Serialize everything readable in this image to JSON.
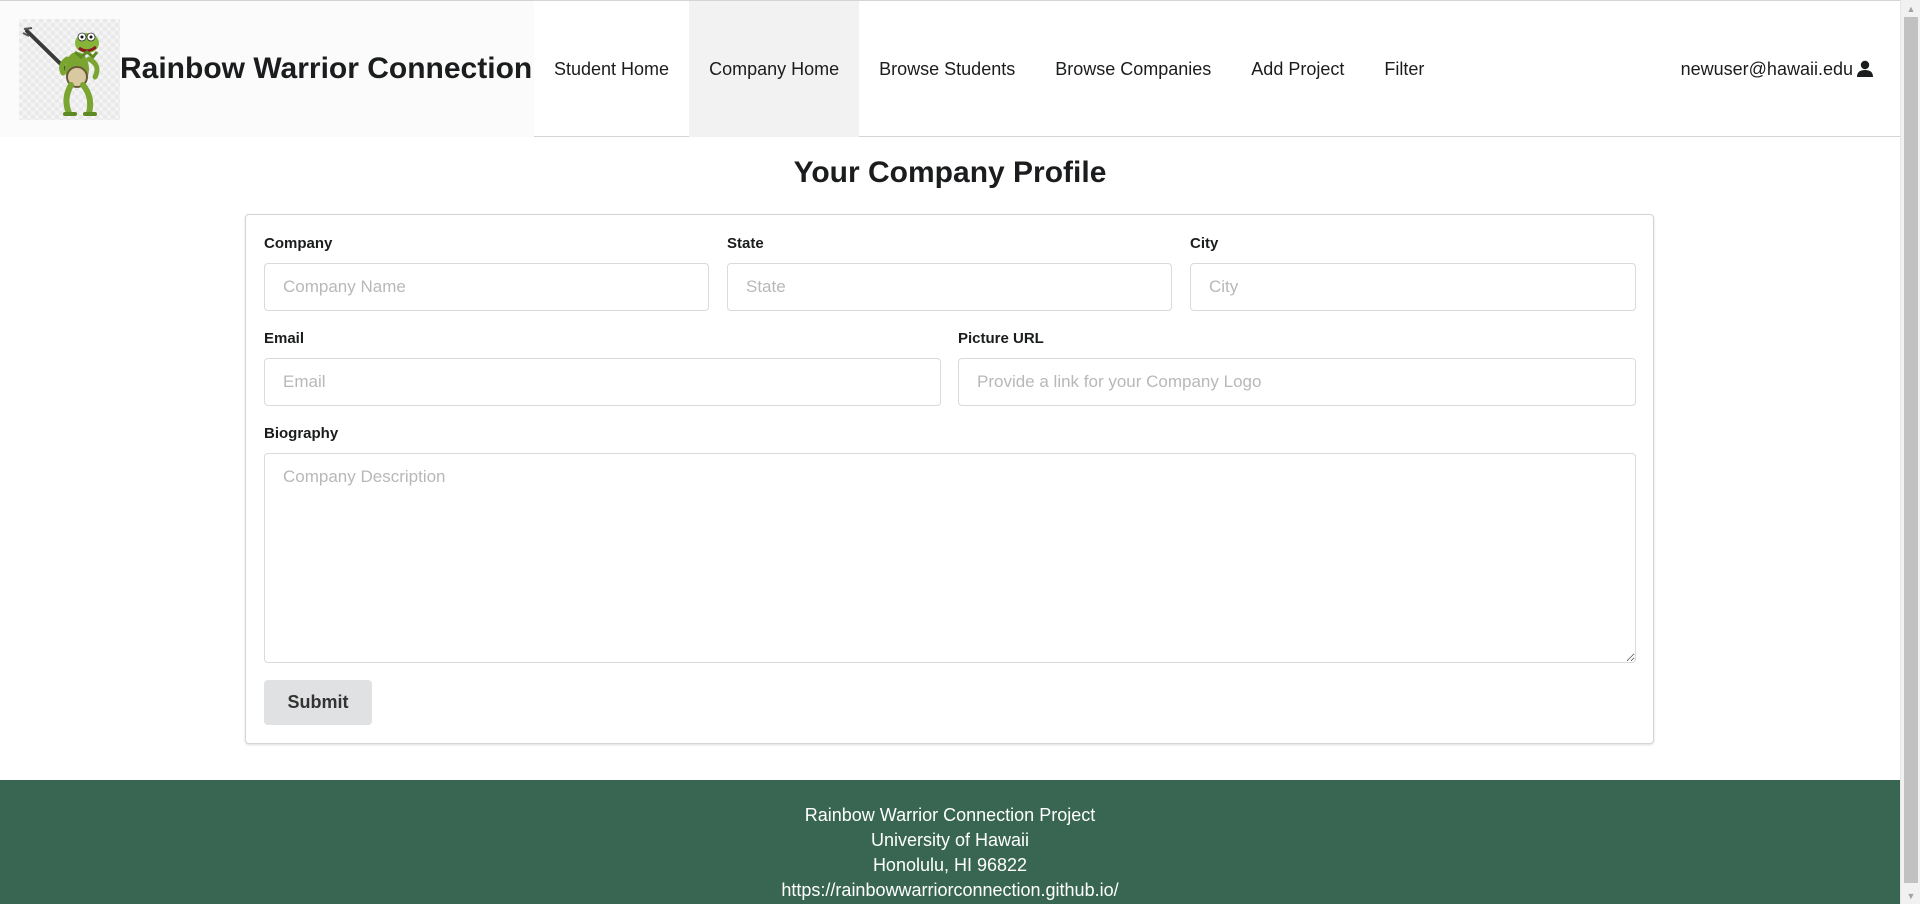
{
  "navbar": {
    "brand_title": "Rainbow Warrior Connection",
    "logo_icon": "kermit-banjo-logo",
    "items": [
      {
        "label": "Student Home",
        "active": false
      },
      {
        "label": "Company Home",
        "active": true
      },
      {
        "label": "Browse Students",
        "active": false
      },
      {
        "label": "Browse Companies",
        "active": false
      },
      {
        "label": "Add Project",
        "active": false
      },
      {
        "label": "Filter",
        "active": false
      }
    ],
    "user_email": "newuser@hawaii.edu",
    "user_icon": "user-icon"
  },
  "page": {
    "title": "Your Company Profile"
  },
  "form": {
    "company": {
      "label": "Company",
      "value": "",
      "placeholder": "Company Name"
    },
    "state": {
      "label": "State",
      "value": "",
      "placeholder": "State"
    },
    "city": {
      "label": "City",
      "value": "",
      "placeholder": "City"
    },
    "email": {
      "label": "Email",
      "value": "",
      "placeholder": "Email"
    },
    "picture_url": {
      "label": "Picture URL",
      "value": "",
      "placeholder": "Provide a link for your Company Logo"
    },
    "biography": {
      "label": "Biography",
      "value": "",
      "placeholder": "Company Description"
    },
    "submit_label": "Submit"
  },
  "footer": {
    "line1": "Rainbow Warrior Connection Project",
    "line2": "University of Hawaii",
    "line3": "Honolulu, HI 96822",
    "line4": "https://rainbowwarriorconnection.github.io/"
  },
  "colors": {
    "footer_bg": "#386652",
    "active_nav_bg": "#f2f2f2",
    "button_bg": "#e0e1e2"
  }
}
